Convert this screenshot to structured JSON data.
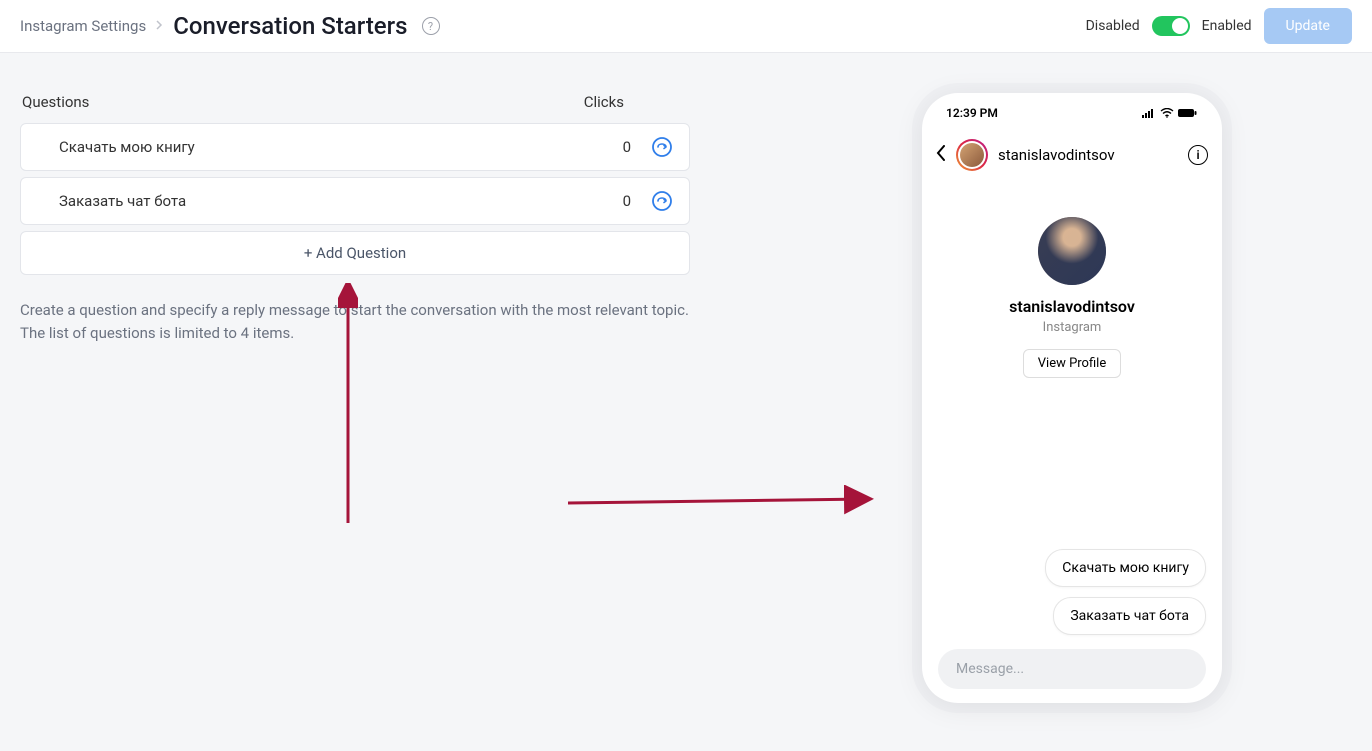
{
  "header": {
    "breadcrumb": "Instagram Settings",
    "title": "Conversation Starters",
    "toggle_left": "Disabled",
    "toggle_right": "Enabled",
    "update_btn": "Update"
  },
  "table": {
    "questions_label": "Questions",
    "clicks_label": "Clicks",
    "rows": [
      {
        "text": "Скачать мою книгу",
        "clicks": "0"
      },
      {
        "text": "Заказать чат бота",
        "clicks": "0"
      }
    ],
    "add_btn": "+ Add Question"
  },
  "help": {
    "line1": "Create a question and specify a reply message to start the conversation with the most relevant topic.",
    "line2": "The list of questions is limited to 4 items."
  },
  "phone": {
    "time": "12:39 PM",
    "username_header": "stanislavodintsov",
    "username": "stanislavodintsov",
    "source": "Instagram",
    "view_profile": "View Profile",
    "bubbles": [
      "Скачать мою книгу",
      "Заказать чат бота"
    ],
    "message_placeholder": "Message..."
  }
}
